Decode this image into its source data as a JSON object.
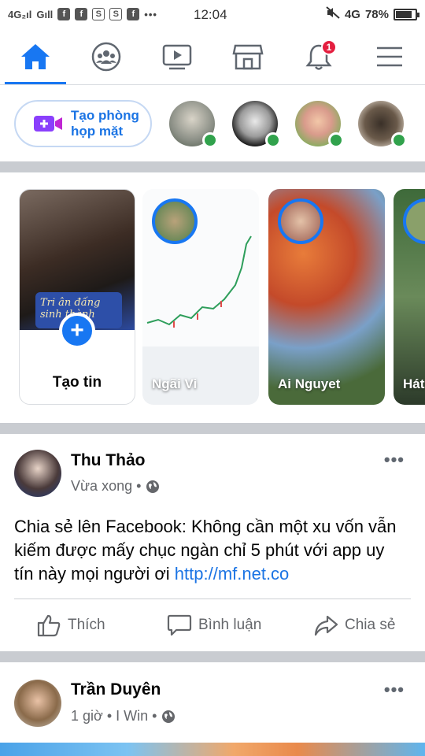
{
  "status_bar": {
    "signal_left": "4G₂ıl",
    "signal_right": "Gıll",
    "time": "12:04",
    "network": "4G",
    "battery_percent": "78%",
    "battery_level": 0.78,
    "more_icon": "•••"
  },
  "nav": {
    "tabs": [
      {
        "id": "home",
        "icon": "home-icon",
        "active": true
      },
      {
        "id": "groups",
        "icon": "groups-icon",
        "active": false
      },
      {
        "id": "watch",
        "icon": "video-icon",
        "active": false
      },
      {
        "id": "marketplace",
        "icon": "marketplace-icon",
        "active": false
      },
      {
        "id": "notifications",
        "icon": "bell-icon",
        "active": false,
        "badge": "1"
      },
      {
        "id": "menu",
        "icon": "hamburger-icon",
        "active": false
      }
    ]
  },
  "rooms": {
    "create_label_line1": "Tạo phòng",
    "create_label_line2": "họp mặt"
  },
  "stories": {
    "create_label": "Tạo tin",
    "create_overlay_text": "Tri ân đấng sinh thành",
    "items": [
      {
        "name": "Ngãi Vi"
      },
      {
        "name": "Ai Nguyet"
      },
      {
        "name": "Hát"
      }
    ]
  },
  "posts": [
    {
      "author": "Thu Thảo",
      "meta": "Vừa xong •",
      "text": "Chia sẻ lên Facebook: Không cần một xu vốn vẫn kiếm được mấy chục ngàn chỉ 5 phút với app uy tín này mọi người ơi ",
      "link": "http://mf.net.co",
      "actions": {
        "like": "Thích",
        "comment": "Bình luận",
        "share": "Chia sẻ"
      }
    },
    {
      "author": "Trần Duyên",
      "meta": "1 giờ • I Win •"
    }
  ],
  "colors": {
    "accent": "#1877f2",
    "badge": "#e41e3f",
    "online": "#31a24c",
    "separator": "#c9ccd1",
    "muted_text": "#65676b"
  }
}
